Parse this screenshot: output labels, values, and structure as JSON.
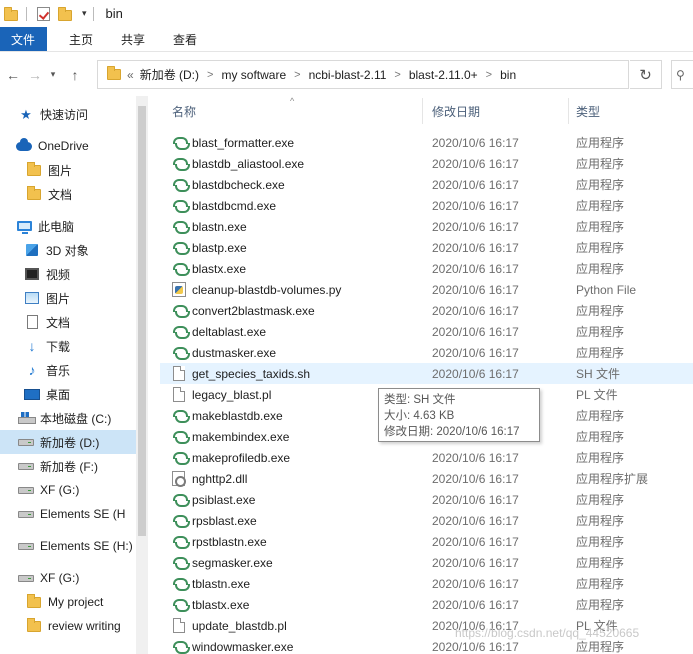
{
  "window": {
    "title": "bin"
  },
  "ribbon": {
    "tabs": [
      "文件",
      "主页",
      "共享",
      "查看"
    ]
  },
  "address": {
    "lead": "«",
    "crumbs": [
      "新加卷 (D:)",
      "my software",
      "ncbi-blast-2.11",
      "blast-2.11.0+",
      "bin"
    ]
  },
  "icons": {
    "back": "back-arrow-icon",
    "forward": "forward-arrow-icon",
    "recent": "chevron-down-icon",
    "up": "up-arrow-icon",
    "refresh": "refresh-icon"
  },
  "nav": {
    "items": [
      {
        "label": "快速访问",
        "icon": "star-icon"
      },
      {
        "label": "OneDrive",
        "icon": "cloud-icon"
      },
      {
        "label": "图片",
        "icon": "folder-icon"
      },
      {
        "label": "文档",
        "icon": "folder-icon"
      },
      {
        "label": "此电脑",
        "icon": "computer-icon"
      },
      {
        "label": "3D 对象",
        "icon": "cube-icon"
      },
      {
        "label": "视频",
        "icon": "video-icon"
      },
      {
        "label": "图片",
        "icon": "pictures-icon"
      },
      {
        "label": "文档",
        "icon": "documents-icon"
      },
      {
        "label": "下载",
        "icon": "download-icon"
      },
      {
        "label": "音乐",
        "icon": "music-icon"
      },
      {
        "label": "桌面",
        "icon": "desktop-icon"
      },
      {
        "label": "本地磁盘 (C:)",
        "icon": "windows-drive-icon"
      },
      {
        "label": "新加卷 (D:)",
        "icon": "drive-icon"
      },
      {
        "label": "新加卷 (F:)",
        "icon": "drive-icon"
      },
      {
        "label": "XF (G:)",
        "icon": "drive-icon"
      },
      {
        "label": "Elements SE (H",
        "icon": "drive-icon"
      },
      {
        "label": "Elements SE (H:)",
        "icon": "drive-icon"
      },
      {
        "label": "XF (G:)",
        "icon": "drive-icon"
      },
      {
        "label": "My project",
        "icon": "folder-icon"
      },
      {
        "label": "review writing",
        "icon": "folder-icon"
      }
    ]
  },
  "columns": {
    "name": "名称",
    "date": "修改日期",
    "type": "类型"
  },
  "files": [
    {
      "name": "blast_formatter.exe",
      "date": "2020/10/6 16:17",
      "type": "应用程序",
      "icon": "exe"
    },
    {
      "name": "blastdb_aliastool.exe",
      "date": "2020/10/6 16:17",
      "type": "应用程序",
      "icon": "exe"
    },
    {
      "name": "blastdbcheck.exe",
      "date": "2020/10/6 16:17",
      "type": "应用程序",
      "icon": "exe"
    },
    {
      "name": "blastdbcmd.exe",
      "date": "2020/10/6 16:17",
      "type": "应用程序",
      "icon": "exe"
    },
    {
      "name": "blastn.exe",
      "date": "2020/10/6 16:17",
      "type": "应用程序",
      "icon": "exe"
    },
    {
      "name": "blastp.exe",
      "date": "2020/10/6 16:17",
      "type": "应用程序",
      "icon": "exe"
    },
    {
      "name": "blastx.exe",
      "date": "2020/10/6 16:17",
      "type": "应用程序",
      "icon": "exe"
    },
    {
      "name": "cleanup-blastdb-volumes.py",
      "date": "2020/10/6 16:17",
      "type": "Python File",
      "icon": "py"
    },
    {
      "name": "convert2blastmask.exe",
      "date": "2020/10/6 16:17",
      "type": "应用程序",
      "icon": "exe"
    },
    {
      "name": "deltablast.exe",
      "date": "2020/10/6 16:17",
      "type": "应用程序",
      "icon": "exe"
    },
    {
      "name": "dustmasker.exe",
      "date": "2020/10/6 16:17",
      "type": "应用程序",
      "icon": "exe"
    },
    {
      "name": "get_species_taxids.sh",
      "date": "2020/10/6 16:17",
      "type": "SH 文件",
      "icon": "file"
    },
    {
      "name": "legacy_blast.pl",
      "date": "",
      "type": "PL 文件",
      "icon": "file"
    },
    {
      "name": "makeblastdb.exe",
      "date": "",
      "type": "应用程序",
      "icon": "exe"
    },
    {
      "name": "makembindex.exe",
      "date": "2020/10/6 16:17",
      "type": "应用程序",
      "icon": "exe"
    },
    {
      "name": "makeprofiledb.exe",
      "date": "2020/10/6 16:17",
      "type": "应用程序",
      "icon": "exe"
    },
    {
      "name": "nghttp2.dll",
      "date": "2020/10/6 16:17",
      "type": "应用程序扩展",
      "icon": "dll"
    },
    {
      "name": "psiblast.exe",
      "date": "2020/10/6 16:17",
      "type": "应用程序",
      "icon": "exe"
    },
    {
      "name": "rpsblast.exe",
      "date": "2020/10/6 16:17",
      "type": "应用程序",
      "icon": "exe"
    },
    {
      "name": "rpstblastn.exe",
      "date": "2020/10/6 16:17",
      "type": "应用程序",
      "icon": "exe"
    },
    {
      "name": "segmasker.exe",
      "date": "2020/10/6 16:17",
      "type": "应用程序",
      "icon": "exe"
    },
    {
      "name": "tblastn.exe",
      "date": "2020/10/6 16:17",
      "type": "应用程序",
      "icon": "exe"
    },
    {
      "name": "tblastx.exe",
      "date": "2020/10/6 16:17",
      "type": "应用程序",
      "icon": "exe"
    },
    {
      "name": "update_blastdb.pl",
      "date": "2020/10/6 16:17",
      "type": "PL 文件",
      "icon": "file"
    },
    {
      "name": "windowmasker.exe",
      "date": "2020/10/6 16:17",
      "type": "应用程序",
      "icon": "exe"
    }
  ],
  "hovered_file_index": 11,
  "tooltip": {
    "type_line": "类型: SH 文件",
    "size_line": "大小: 4.63 KB",
    "date_line": "修改日期: 2020/10/6 16:17"
  },
  "watermark": "https://blog.csdn.net/qq_44520665",
  "colors": {
    "accent": "#1a64b8",
    "selection": "#cce4f7",
    "hover": "#e5f3ff",
    "header_text": "#4c607a",
    "secondary_text": "#6d6d6d"
  }
}
